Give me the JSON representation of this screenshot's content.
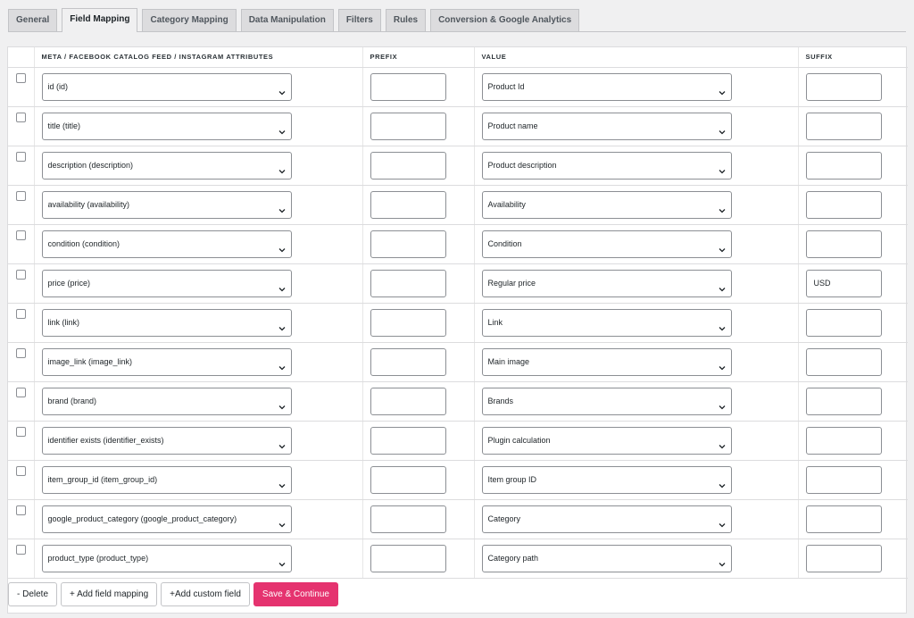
{
  "tabs": [
    {
      "label": "General"
    },
    {
      "label": "Field Mapping"
    },
    {
      "label": "Category Mapping"
    },
    {
      "label": "Data Manipulation"
    },
    {
      "label": "Filters"
    },
    {
      "label": "Rules"
    },
    {
      "label": "Conversion & Google Analytics"
    }
  ],
  "active_tab": "Field Mapping",
  "columns": {
    "attribute": "META / FACEBOOK CATALOG FEED / INSTAGRAM ATTRIBUTES",
    "prefix": "PREFIX",
    "value": "VALUE",
    "suffix": "SUFFIX"
  },
  "rows": [
    {
      "attribute": "id (id)",
      "prefix": "",
      "value": "Product Id",
      "suffix": ""
    },
    {
      "attribute": "title (title)",
      "prefix": "",
      "value": "Product name",
      "suffix": ""
    },
    {
      "attribute": "description (description)",
      "prefix": "",
      "value": "Product description",
      "suffix": ""
    },
    {
      "attribute": "availability (availability)",
      "prefix": "",
      "value": "Availability",
      "suffix": ""
    },
    {
      "attribute": "condition (condition)",
      "prefix": "",
      "value": "Condition",
      "suffix": ""
    },
    {
      "attribute": "price (price)",
      "prefix": "",
      "value": "Regular price",
      "suffix": "USD"
    },
    {
      "attribute": "link (link)",
      "prefix": "",
      "value": "Link",
      "suffix": ""
    },
    {
      "attribute": "image_link (image_link)",
      "prefix": "",
      "value": "Main image",
      "suffix": ""
    },
    {
      "attribute": "brand (brand)",
      "prefix": "",
      "value": "Brands",
      "suffix": ""
    },
    {
      "attribute": "identifier exists (identifier_exists)",
      "prefix": "",
      "value": "Plugin calculation",
      "suffix": ""
    },
    {
      "attribute": "item_group_id (item_group_id)",
      "prefix": "",
      "value": "Item group ID",
      "suffix": ""
    },
    {
      "attribute": "google_product_category (google_product_category)",
      "prefix": "",
      "value": "Category",
      "suffix": ""
    },
    {
      "attribute": "product_type (product_type)",
      "prefix": "",
      "value": "Category path",
      "suffix": ""
    }
  ],
  "footer": {
    "delete_label": "- Delete",
    "add_field_mapping_label": "+ Add field mapping",
    "add_custom_field_label": "+Add custom field",
    "save_continue_label": "Save & Continue"
  },
  "colors": {
    "primary_button": "#e5336f",
    "active_tab_bg": "#f0f0f1",
    "tab_bg": "#dcdcde"
  },
  "icons": {
    "select_arrow": "chevron-down-icon"
  }
}
